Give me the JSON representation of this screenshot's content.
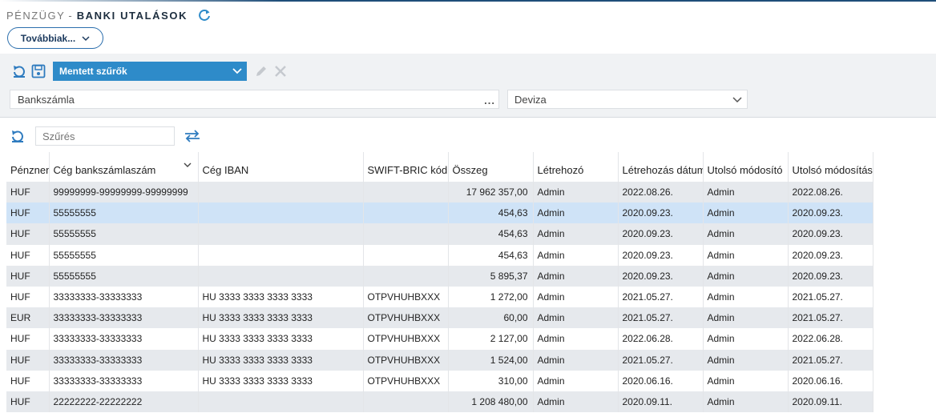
{
  "header": {
    "module": "PÉNZÜGY",
    "separator": "-",
    "title": "BANKI UTALÁSOK"
  },
  "more_button": {
    "label": "Továbbiak..."
  },
  "filter_panel": {
    "saved_filters_label": "Mentett szűrők",
    "bank_account_field": {
      "value": "Bankszámla",
      "dots": "..."
    },
    "currency_field": {
      "value": "Deviza"
    }
  },
  "search": {
    "placeholder": "Szűrés"
  },
  "colors": {
    "accent": "#2e8bc9",
    "row_alt": "#e6e9ed",
    "row_selected": "#cfe3f7",
    "title": "#1c2d3e"
  },
  "table": {
    "columns": [
      "Pénznem",
      "Cég bankszámlaszám",
      "Cég IBAN",
      "SWIFT-BRIC kód",
      "Összeg",
      "Létrehozó",
      "Létrehozás dátuma",
      "Utolsó módosító",
      "Utolsó módosítás"
    ],
    "selected_row_index": 1,
    "rows": [
      [
        "HUF",
        "99999999-99999999-99999999",
        "",
        "",
        "17 962 357,00",
        "Admin",
        "2022.08.26.",
        "Admin",
        "2022.08.26."
      ],
      [
        "HUF",
        "55555555",
        "",
        "",
        "454,63",
        "Admin",
        "2020.09.23.",
        "Admin",
        "2020.09.23."
      ],
      [
        "HUF",
        "55555555",
        "",
        "",
        "454,63",
        "Admin",
        "2020.09.23.",
        "Admin",
        "2020.09.23."
      ],
      [
        "HUF",
        "55555555",
        "",
        "",
        "454,63",
        "Admin",
        "2020.09.23.",
        "Admin",
        "2020.09.23."
      ],
      [
        "HUF",
        "55555555",
        "",
        "",
        "5 895,37",
        "Admin",
        "2020.09.23.",
        "Admin",
        "2020.09.23."
      ],
      [
        "HUF",
        "33333333-33333333",
        "HU 3333 3333 3333 3333",
        "OTPVHUHBXXX",
        "1 272,00",
        "Admin",
        "2021.05.27.",
        "Admin",
        "2021.05.27."
      ],
      [
        "EUR",
        "33333333-33333333",
        "HU 3333 3333 3333 3333",
        "OTPVHUHBXXX",
        "60,00",
        "Admin",
        "2021.05.27.",
        "Admin",
        "2021.05.27."
      ],
      [
        "HUF",
        "33333333-33333333",
        "HU 3333 3333 3333 3333",
        "OTPVHUHBXXX",
        "2 127,00",
        "Admin",
        "2022.06.28.",
        "Admin",
        "2022.06.28."
      ],
      [
        "HUF",
        "33333333-33333333",
        "HU 3333 3333 3333 3333",
        "OTPVHUHBXXX",
        "1 524,00",
        "Admin",
        "2021.05.27.",
        "Admin",
        "2021.05.27."
      ],
      [
        "HUF",
        "33333333-33333333",
        "HU 3333 3333 3333 3333",
        "OTPVHUHBXXX",
        "310,00",
        "Admin",
        "2020.06.16.",
        "Admin",
        "2020.06.16."
      ],
      [
        "HUF",
        "22222222-22222222",
        "",
        "",
        "1 208 480,00",
        "Admin",
        "2020.09.11.",
        "Admin",
        "2020.09.11."
      ]
    ]
  }
}
